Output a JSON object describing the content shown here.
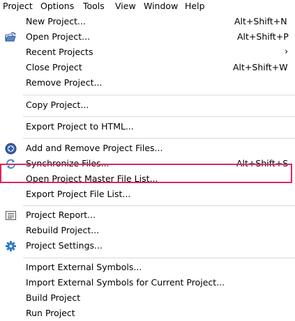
{
  "menubar": {
    "items": [
      "Project",
      "Options",
      "Tools",
      "View",
      "Window",
      "Help"
    ]
  },
  "menu": {
    "new_project": {
      "label": "New Project...",
      "shortcut": "Alt+Shift+N"
    },
    "open_project": {
      "label": "Open Project...",
      "shortcut": "Alt+Shift+P"
    },
    "recent_projects": {
      "label": "Recent Projects"
    },
    "close_project": {
      "label": "Close Project",
      "shortcut": "Alt+Shift+W"
    },
    "remove_project": {
      "label": "Remove Project..."
    },
    "copy_project": {
      "label": "Copy Project..."
    },
    "export_html": {
      "label": "Export Project to HTML..."
    },
    "add_remove_files": {
      "label": "Add and Remove Project Files..."
    },
    "synchronize_files": {
      "label": "Synchronize Files...",
      "shortcut": "Alt+Shift+S"
    },
    "open_master_list": {
      "label": "Open Project Master File List..."
    },
    "export_file_list": {
      "label": "Export Project File List..."
    },
    "project_report": {
      "label": "Project Report..."
    },
    "rebuild_project": {
      "label": "Rebuild Project..."
    },
    "project_settings": {
      "label": "Project Settings..."
    },
    "import_symbols": {
      "label": "Import External Symbols..."
    },
    "import_symbols_current": {
      "label": "Import External Symbols for Current Project..."
    },
    "build_project": {
      "label": "Build Project"
    },
    "run_project": {
      "label": "Run Project"
    }
  },
  "colors": {
    "highlight_border": "#e0245e",
    "separator": "#d9d9d9"
  }
}
